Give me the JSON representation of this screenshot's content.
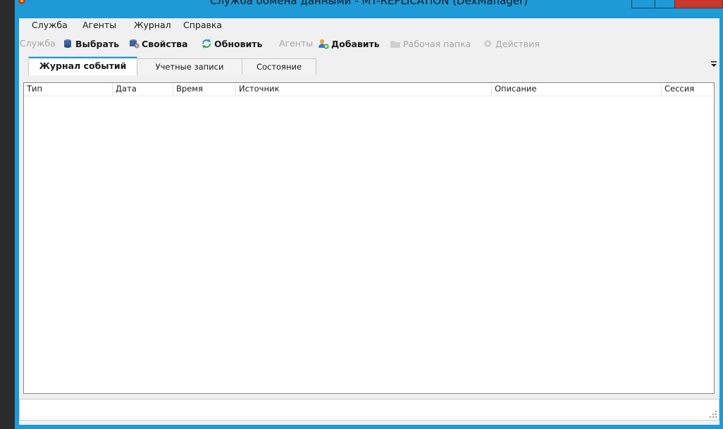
{
  "window": {
    "title": "Служба обмена данными - MT-REPLICATION (DexManager)"
  },
  "menubar": {
    "items": [
      "Служба",
      "Агенты",
      "Журнал",
      "Справка"
    ]
  },
  "toolbar": {
    "service_label": "Служба",
    "select_label": "Выбрать",
    "properties_label": "Свойства",
    "refresh_label": "Обновить",
    "agents_label": "Агенты",
    "add_label": "Добавить",
    "workfolder_label": "Рабочая папка",
    "actions_label": "Действия"
  },
  "tabs": [
    {
      "label": "Журнал событий",
      "active": true
    },
    {
      "label": "Учетные записи",
      "active": false
    },
    {
      "label": "Состояние",
      "active": false
    }
  ],
  "event_log": {
    "columns": [
      "Тип",
      "Дата",
      "Время",
      "Источник",
      "Описание",
      "Сессия"
    ],
    "rows": []
  },
  "statusbar": {
    "text": ""
  },
  "colors": {
    "titlebar": "#1e9ad6",
    "client_bg": "#f0f0f0",
    "close_button": "#c7372d",
    "disabled_text": "#a7a7a7"
  }
}
